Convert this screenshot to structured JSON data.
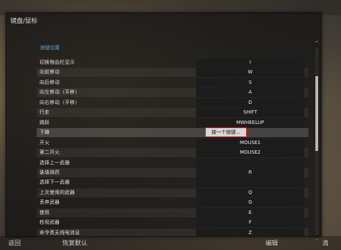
{
  "window": {
    "title": "键盘/鼠标"
  },
  "section_title": "按键设置",
  "bindings": [
    {
      "action": "切换物品栏显示",
      "key": "I"
    },
    {
      "action": "向前移动",
      "key": "W"
    },
    {
      "action": "向后移动",
      "key": "S"
    },
    {
      "action": "向左移动（平移）",
      "key": "A"
    },
    {
      "action": "向右移动（平移）",
      "key": "D"
    },
    {
      "action": "行走",
      "key": "SHIFT"
    },
    {
      "action": "跳跃",
      "key": "MWHEELUP"
    },
    {
      "action": "下蹲",
      "key": "按一个按键..."
    },
    {
      "action": "开火",
      "key": "MOUSE1"
    },
    {
      "action": "第二开火",
      "key": "MOUSE2"
    },
    {
      "action": "选择上一武器",
      "key": ""
    },
    {
      "action": "装填弹药",
      "key": "R"
    },
    {
      "action": "选择下一武器",
      "key": ""
    },
    {
      "action": "上次使用的武器",
      "key": "Q"
    },
    {
      "action": "丢弃武器",
      "key": "G"
    },
    {
      "action": "使用",
      "key": "E"
    },
    {
      "action": "检视武器",
      "key": "F"
    },
    {
      "action": "命令类无线电消息",
      "key": "Z"
    }
  ],
  "selected_index": 7,
  "footer": {
    "back": "返回",
    "restore_defaults": "恢复默认",
    "edit": "编辑",
    "clear": "清"
  },
  "scrollbar": {
    "position_fraction": 0.15,
    "visible_fraction": 0.4
  },
  "colors": {
    "accent": "#5fa3d8",
    "highlight_border": "#e02020"
  }
}
